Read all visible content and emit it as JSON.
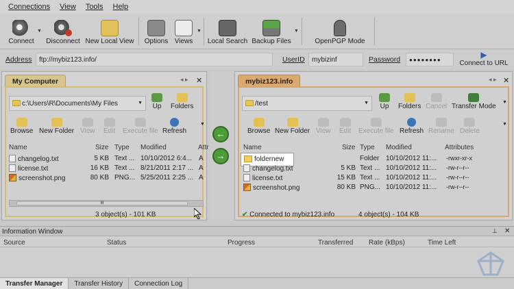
{
  "menu": [
    "Connections",
    "View",
    "Tools",
    "Help"
  ],
  "toolbar": {
    "connect": "Connect",
    "disconnect": "Disconnect",
    "new_local_view": "New Local View",
    "options": "Options",
    "views": "Views",
    "local_search": "Local Search",
    "backup_files": "Backup Files",
    "openpgp_mode": "OpenPGP Mode"
  },
  "address_bar": {
    "address_label": "Address",
    "address_value": "ftp://mybiz123.info/",
    "userid_label": "UserID",
    "userid_value": "mybizinf",
    "password_label": "Password",
    "password_value": "●●●●●●●●",
    "connect_to_url": "Connect to URL"
  },
  "local_panel": {
    "title": "My Computer",
    "path": "c:\\Users\\R\\Documents\\My Files",
    "up": "Up",
    "folders": "Folders",
    "buttons": {
      "browse": "Browse",
      "new_folder": "New Folder",
      "view": "View",
      "edit": "Edit",
      "execute_file": "Execute file",
      "refresh": "Refresh"
    },
    "columns": [
      "Name",
      "Size",
      "Type",
      "Modified",
      "Attr"
    ],
    "rows": [
      {
        "name": "changelog.txt",
        "size": "5 KB",
        "type": "Text ...",
        "modified": "10/10/2012 6:4...",
        "attr": "A"
      },
      {
        "name": "license.txt",
        "size": "16 KB",
        "type": "Text ...",
        "modified": "8/21/2011 2:17 ...",
        "attr": "A"
      },
      {
        "name": "screenshot.png",
        "size": "80 KB",
        "type": "PNG...",
        "modified": "5/25/2011 2:25 ...",
        "attr": "A"
      }
    ],
    "status": "3 object(s) - 101 KB",
    "scroll_indicator": "III"
  },
  "remote_panel": {
    "title": "mybiz123.info",
    "path": "/test",
    "up": "Up",
    "folders": "Folders",
    "cancel": "Cancel",
    "transfer_mode": "Transfer Mode",
    "buttons": {
      "browse": "Browse",
      "new_folder": "New Folder",
      "view": "View",
      "edit": "Edit",
      "execute_file": "Execute file",
      "refresh": "Refresh",
      "rename": "Rename",
      "delete": "Delete"
    },
    "columns": [
      "Name",
      "Size",
      "Type",
      "Modified",
      "Attributes"
    ],
    "rows": [
      {
        "name": "foldernew",
        "size": "",
        "type": "Folder",
        "modified": "10/10/2012 11:...",
        "attr": "-rwxr-xr-x"
      },
      {
        "name": "changelog.txt",
        "size": "5 KB",
        "type": "Text ...",
        "modified": "10/10/2012 11:...",
        "attr": "-rw-r--r--"
      },
      {
        "name": "license.txt",
        "size": "15 KB",
        "type": "Text ...",
        "modified": "10/10/2012 11:...",
        "attr": "-rw-r--r--"
      },
      {
        "name": "screenshot.png",
        "size": "80 KB",
        "type": "PNG...",
        "modified": "10/10/2012 11:...",
        "attr": "-rw-r--r--"
      }
    ],
    "status_connected": "Connected to mybiz123.info",
    "status_objects": "4 object(s) - 104 KB"
  },
  "info_window": {
    "title": "Information Window",
    "columns": [
      "Source",
      "Status",
      "Progress",
      "Transferred",
      "Rate (kBps)",
      "Time Left"
    ]
  },
  "tabs": [
    "Transfer Manager",
    "Transfer History",
    "Connection Log"
  ],
  "colors": {
    "local_accent": "#d4bd6c",
    "remote_accent": "#d7a66b",
    "arrow_green": "#4f9a3a"
  }
}
